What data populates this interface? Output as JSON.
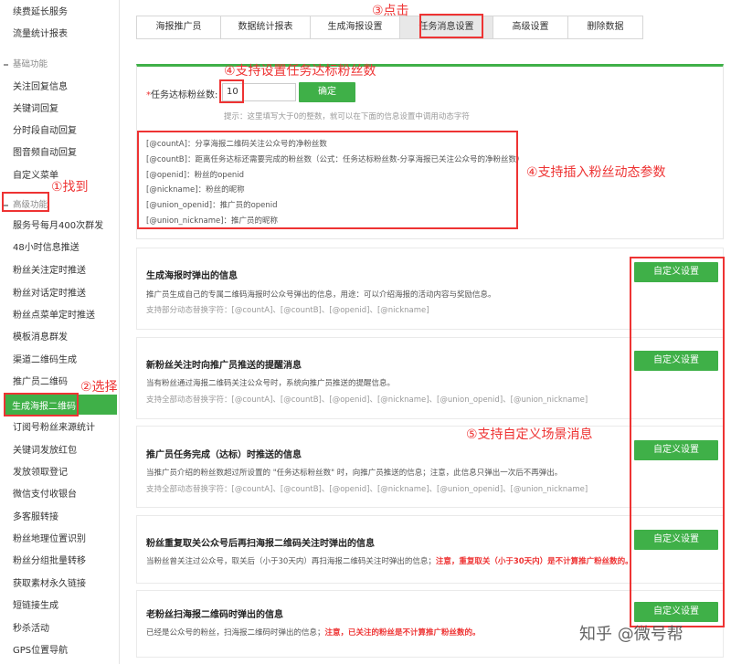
{
  "sidebar": {
    "items_top": [
      "续费延长服务",
      "流量统计报表"
    ],
    "section_basic": "基础功能",
    "items_basic": [
      "关注回复信息",
      "关键词回复",
      "分时段自动回复",
      "图音频自动回复",
      "自定义菜单"
    ],
    "section_advanced": "高级功能",
    "items_advanced": [
      "服务号每月400次群发",
      "48小时信息推送",
      "粉丝关注定时推送",
      "粉丝对话定时推送",
      "粉丝点菜单定时推送",
      "模板消息群发",
      "渠道二维码生成",
      "推广员二维码"
    ],
    "active_item": "生成海报二维码",
    "items_bottom": [
      "订阅号粉丝来源统计",
      "关键词发放红包",
      "发放领取登记",
      "微信支付收银台",
      "多客服转接",
      "粉丝地理位置识别",
      "粉丝分组批量转移",
      "获取素材永久链接",
      "短链接生成",
      "秒杀活动",
      "GPS位置导航"
    ]
  },
  "tabs": [
    "海报推广员",
    "数据统计报表",
    "生成海报设置",
    "任务消息设置",
    "高级设置",
    "删除数据"
  ],
  "active_tab": "任务消息设置",
  "form": {
    "label_prefix": "*",
    "label": "任务达标粉丝数:",
    "value": "10",
    "confirm_label": "确定",
    "hint": "提示：这里填写大于0的整数，就可以在下面的信息设置中调用动态字符"
  },
  "variables": [
    "[@countA]：分享海报二维码关注公众号的净粉丝数",
    "[@countB]：距离任务达标还需要完成的粉丝数（公式：任务达标粉丝数-分享海报已关注公众号的净粉丝数）",
    "[@openid]：粉丝的openid",
    "[@nickname]：粉丝的昵称",
    "[@union_openid]：推广员的openid",
    "[@union_nickname]：推广员的昵称"
  ],
  "cards": [
    {
      "title": "生成海报时弹出的信息",
      "desc": "推广员生成自己的专属二维码海报时公众号弹出的信息，用途：可以介绍海报的活动内容与奖励信息。",
      "vars": "支持部分动态替换字符：[@countA]、[@countB]、[@openid]、[@nickname]",
      "button": "自定义设置"
    },
    {
      "title": "新粉丝关注时向推广员推送的提醒消息",
      "desc": "当有粉丝通过海报二维码关注公众号时，系统向推广员推送的提醒信息。",
      "vars": "支持全部动态替换字符：[@countA]、[@countB]、[@openid]、[@nickname]、[@union_openid]、[@union_nickname]",
      "button": "自定义设置"
    },
    {
      "title": "推广员任务完成（达标）时推送的信息",
      "desc": "当推广员介绍的粉丝数超过所设置的 \"任务达标粉丝数\" 时，向推广员推送的信息；注意，此信息只弹出一次后不再弹出。",
      "vars": "支持全部动态替换字符：[@countA]、[@countB]、[@openid]、[@nickname]、[@union_openid]、[@union_nickname]",
      "button": "自定义设置"
    },
    {
      "title": "粉丝重复取关公众号后再扫海报二维码关注时弹出的信息",
      "desc": "当粉丝曾关注过公众号，取关后（小于30天内）再扫海报二维码关注时弹出的信息；",
      "desc_red": "注意，重复取关（小于30天内）是不计算推广粉丝数的。",
      "vars": "",
      "button": "自定义设置"
    },
    {
      "title": "老粉丝扫海报二维码时弹出的信息",
      "desc": "已经是公众号的粉丝，扫海报二维码时弹出的信息；",
      "desc_red": "注意，已关注的粉丝是不计算推广粉丝数的。",
      "vars": "",
      "button": "自定义设置"
    }
  ],
  "annotations": {
    "find": "①找到",
    "select": "②选择",
    "click": "③点击",
    "set_target": "④支持设置任务达标粉丝数",
    "insert_vars": "④支持插入粉丝动态参数",
    "custom_scene": "⑤支持自定义场景消息"
  },
  "watermark": "知乎 @微号帮",
  "colors": {
    "accent": "#3fb048",
    "annotation": "#e33333"
  }
}
